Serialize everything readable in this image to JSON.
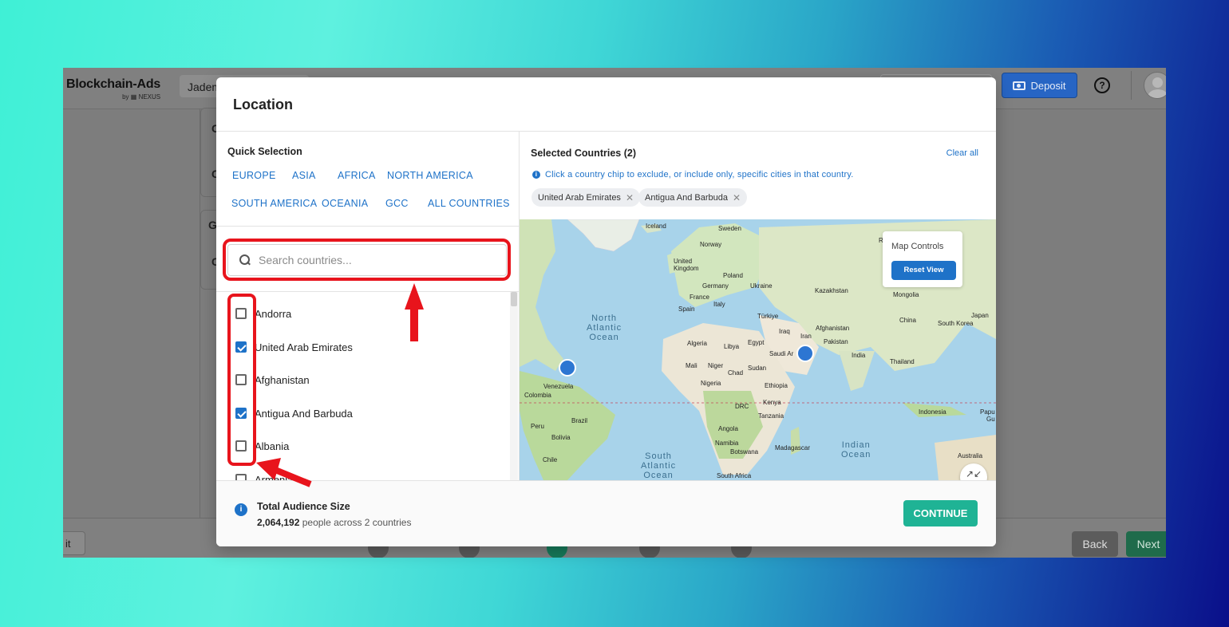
{
  "app": {
    "brand": "Blockchain-Ads",
    "brand_sub": "by ▦ NEXUS",
    "workspace": "Jadem",
    "deposit_label": "Deposit",
    "help_symbol": "?",
    "bg_side_letters": [
      "C",
      "C",
      "G",
      "C"
    ],
    "exit_label": "it",
    "back_label": "Back",
    "next_label": "Next"
  },
  "modal": {
    "title": "Location",
    "quick_selection": {
      "title": "Quick Selection",
      "regions": [
        "EUROPE",
        "ASIA",
        "AFRICA",
        "NORTH AMERICA",
        "SOUTH AMERICA",
        "OCEANIA",
        "GCC",
        "ALL COUNTRIES"
      ]
    },
    "search": {
      "placeholder": "Search countries...",
      "value": ""
    },
    "countries": [
      {
        "name": "Andorra",
        "checked": false
      },
      {
        "name": "United Arab Emirates",
        "checked": true
      },
      {
        "name": "Afghanistan",
        "checked": false
      },
      {
        "name": "Antigua And Barbuda",
        "checked": true
      },
      {
        "name": "Albania",
        "checked": false
      },
      {
        "name": "Armenia",
        "checked": false
      }
    ],
    "selected": {
      "title": "Selected Countries (2)",
      "clear_all": "Clear all",
      "hint": "Click a country chip to exclude, or include only, specific cities in that country.",
      "chips": [
        "United Arab Emirates",
        "Antigua And Barbuda"
      ]
    },
    "map": {
      "controls_title": "Map Controls",
      "reset_label": "Reset View",
      "fullscreen_symbol": "↗↙",
      "labels": {
        "iceland": "Iceland",
        "sweden": "Sweden",
        "norway": "Norway",
        "uk": "United\nKingdom",
        "poland": "Poland",
        "germany": "Germany",
        "ukraine": "Ukraine",
        "france": "France",
        "kazakhstan": "Kazakhstan",
        "mongolia": "Mongolia",
        "spain": "Spain",
        "italy": "Italy",
        "turkiye": "Türkiye",
        "china": "China",
        "south_korea": "South Korea",
        "japan": "Japan",
        "iraq": "Iraq",
        "iran": "Iran",
        "afghanistan": "Afghanistan",
        "pakistan": "Pakistan",
        "algeria": "Algeria",
        "libya": "Libya",
        "egypt": "Egypt",
        "saudi": "Saudi Ar",
        "india": "India",
        "thailand": "Thailand",
        "mali": "Mali",
        "niger": "Niger",
        "chad": "Chad",
        "sudan": "Sudan",
        "venezuela": "Venezuela",
        "colombia": "Colombia",
        "nigeria": "Nigeria",
        "ethiopia": "Ethiopia",
        "kenya": "Kenya",
        "drc": "DRC",
        "tanzania": "Tanzania",
        "indonesia": "Indonesia",
        "peru": "Peru",
        "brazil": "Brazil",
        "bolivia": "Bolivia",
        "angola": "Angola",
        "namibia": "Namibia",
        "botswana": "Botswana",
        "madagascar": "Madagascar",
        "chile": "Chile",
        "south_africa": "South Africa",
        "australia": "Australia",
        "papua": "Papu",
        "gu": "Gu",
        "ri": "Ri"
      },
      "oceans": {
        "north_atlantic": "North\nAtlantic\nOcean",
        "south_atlantic": "South\nAtlantic\nOcean",
        "indian": "Indian\nOcean"
      }
    },
    "footer": {
      "title": "Total Audience Size",
      "count": "2,064,192",
      "suffix": "people across 2 countries",
      "continue_label": "CONTINUE"
    }
  },
  "colors": {
    "accent": "#1e72c8",
    "continue": "#1fb395",
    "annotation": "#e8141c",
    "marker": "#2d76d2"
  }
}
